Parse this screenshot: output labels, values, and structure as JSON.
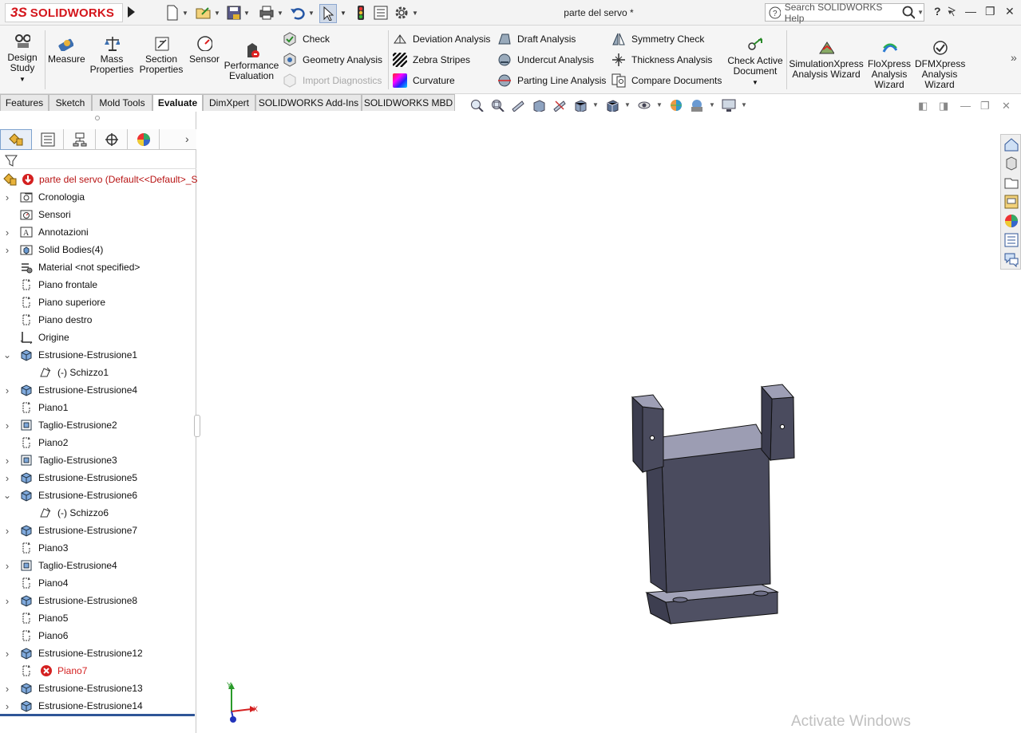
{
  "app": {
    "logo_ds": "3S",
    "logo_text": "SOLIDWORKS",
    "document_title": "parte del servo *",
    "search_placeholder": "Search SOLIDWORKS Help",
    "help_label": "?"
  },
  "ribbon": {
    "design_study": [
      "Design",
      "Study"
    ],
    "measure": "Measure",
    "mass_properties": [
      "Mass",
      "Properties"
    ],
    "section_properties": [
      "Section",
      "Properties"
    ],
    "sensor": "Sensor",
    "performance_evaluation": [
      "Performance",
      "Evaluation"
    ],
    "check": "Check",
    "geometry_analysis": "Geometry Analysis",
    "import_diagnostics": "Import Diagnostics",
    "deviation_analysis": "Deviation Analysis",
    "zebra_stripes": "Zebra Stripes",
    "curvature": "Curvature",
    "draft_analysis": "Draft Analysis",
    "undercut_analysis": "Undercut Analysis",
    "parting_line_analysis": "Parting Line Analysis",
    "symmetry_check": "Symmetry Check",
    "thickness_analysis": "Thickness Analysis",
    "compare_documents": "Compare Documents",
    "check_active_document": [
      "Check Active",
      "Document"
    ],
    "simulationxpress": [
      "SimulationXpress",
      "Analysis Wizard"
    ],
    "floxpress": [
      "FloXpress",
      "Analysis",
      "Wizard"
    ],
    "dfmxpress": [
      "DFMXpress",
      "Analysis",
      "Wizard"
    ]
  },
  "tabs": [
    "Features",
    "Sketch",
    "Mold Tools",
    "Evaluate",
    "DimXpert",
    "SOLIDWORKS Add-Ins",
    "SOLIDWORKS MBD"
  ],
  "active_tab": "Evaluate",
  "tree": {
    "root": "parte del servo  (Default<<Default>_S",
    "items": [
      {
        "label": "Cronologia",
        "icon": "history-folder-icon",
        "exp": ">"
      },
      {
        "label": "Sensori",
        "icon": "sensor-folder-icon",
        "exp": ""
      },
      {
        "label": "Annotazioni",
        "icon": "annotations-icon",
        "exp": ">"
      },
      {
        "label": "Solid Bodies(4)",
        "icon": "solid-bodies-icon",
        "exp": ">"
      },
      {
        "label": "Material <not specified>",
        "icon": "material-icon",
        "exp": ""
      },
      {
        "label": "Piano frontale",
        "icon": "plane-icon",
        "exp": ""
      },
      {
        "label": "Piano superiore",
        "icon": "plane-icon",
        "exp": ""
      },
      {
        "label": "Piano destro",
        "icon": "plane-icon",
        "exp": ""
      },
      {
        "label": "Origine",
        "icon": "origin-icon",
        "exp": ""
      },
      {
        "label": "Estrusione-Estrusione1",
        "icon": "extrude-icon",
        "exp": "v"
      },
      {
        "label": "(-) Schizzo1",
        "icon": "sketch-icon",
        "exp": "",
        "indent": true
      },
      {
        "label": "Estrusione-Estrusione4",
        "icon": "extrude-icon",
        "exp": ">"
      },
      {
        "label": "Piano1",
        "icon": "plane-icon",
        "exp": ""
      },
      {
        "label": "Taglio-Estrusione2",
        "icon": "cut-extrude-icon",
        "exp": ">"
      },
      {
        "label": "Piano2",
        "icon": "plane-icon",
        "exp": ""
      },
      {
        "label": "Taglio-Estrusione3",
        "icon": "cut-extrude-icon",
        "exp": ">"
      },
      {
        "label": "Estrusione-Estrusione5",
        "icon": "extrude-icon",
        "exp": ">"
      },
      {
        "label": "Estrusione-Estrusione6",
        "icon": "extrude-icon",
        "exp": "v"
      },
      {
        "label": "(-) Schizzo6",
        "icon": "sketch-icon",
        "exp": "",
        "indent": true
      },
      {
        "label": "Estrusione-Estrusione7",
        "icon": "extrude-icon",
        "exp": ">"
      },
      {
        "label": "Piano3",
        "icon": "plane-icon",
        "exp": ""
      },
      {
        "label": "Taglio-Estrusione4",
        "icon": "cut-extrude-icon",
        "exp": ">"
      },
      {
        "label": "Piano4",
        "icon": "plane-icon",
        "exp": ""
      },
      {
        "label": "Estrusione-Estrusione8",
        "icon": "extrude-icon",
        "exp": ">"
      },
      {
        "label": "Piano5",
        "icon": "plane-icon",
        "exp": ""
      },
      {
        "label": "Piano6",
        "icon": "plane-icon",
        "exp": ""
      },
      {
        "label": "Estrusione-Estrusione12",
        "icon": "extrude-icon",
        "exp": ">"
      },
      {
        "label": "Piano7",
        "icon": "plane-icon",
        "exp": "",
        "error": true
      },
      {
        "label": "Estrusione-Estrusione13",
        "icon": "extrude-icon",
        "exp": ">"
      },
      {
        "label": "Estrusione-Estrusione14",
        "icon": "extrude-icon",
        "exp": ">"
      }
    ]
  },
  "triad": {
    "y": "Y",
    "x": "X"
  },
  "watermark": "Activate Windows",
  "colors": {
    "brand_red": "#d4161c",
    "part_face": "#4a4b5e",
    "part_top": "#9c9db3",
    "error_red": "#d42020"
  }
}
